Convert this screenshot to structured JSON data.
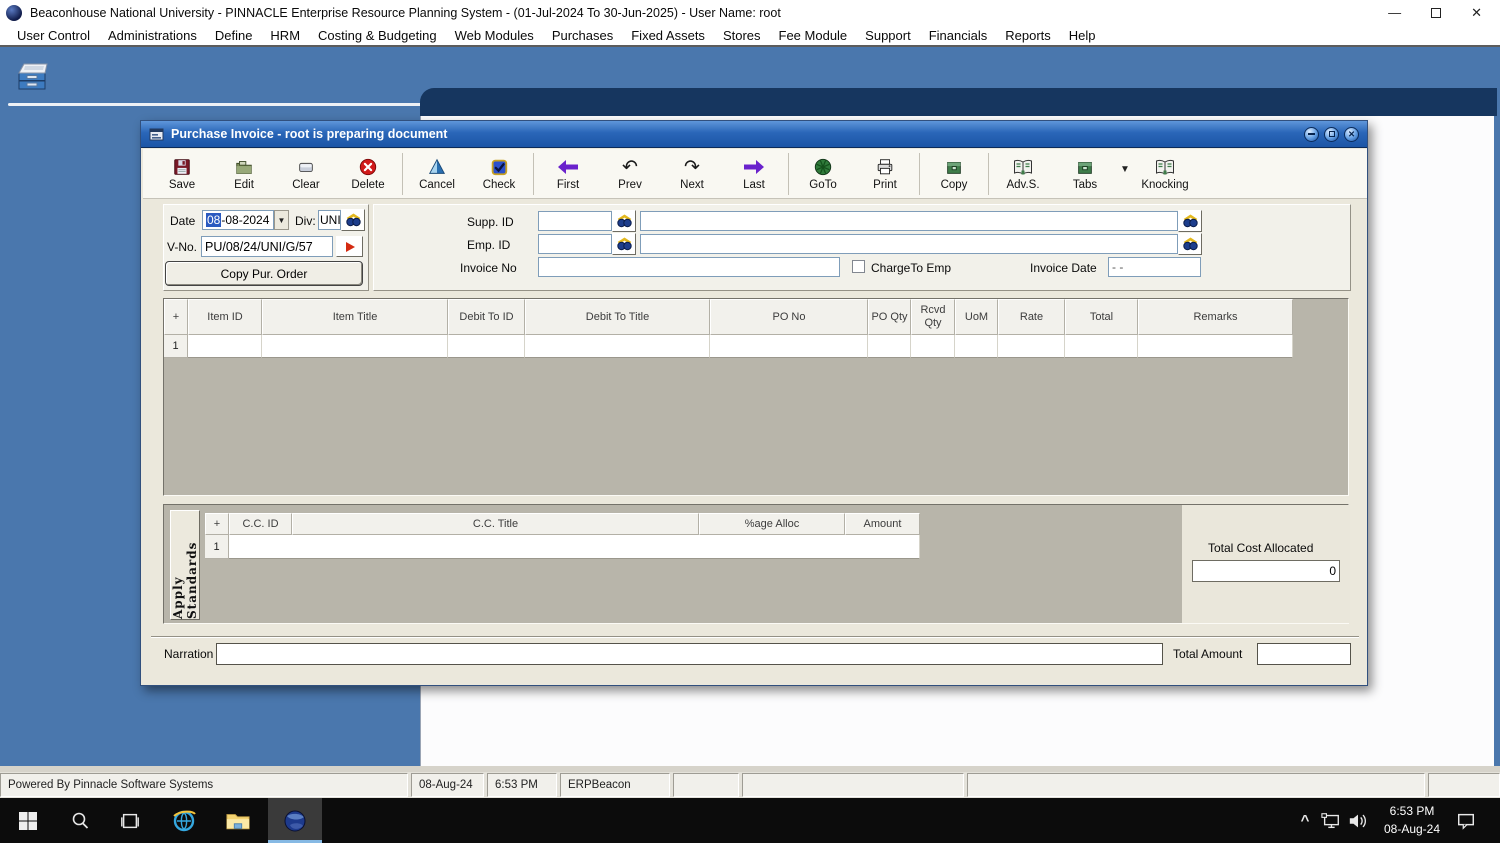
{
  "window": {
    "title": "Beaconhouse National University - PINNACLE Enterprise Resource Planning System - (01-Jul-2024 To 30-Jun-2025) - User Name: root"
  },
  "menubar": {
    "items": [
      "User Control",
      "Administrations",
      "Define",
      "HRM",
      "Costing & Budgeting",
      "Web Modules",
      "Purchases",
      "Fixed Assets",
      "Stores",
      "Fee Module",
      "Support",
      "Financials",
      "Reports",
      "Help"
    ]
  },
  "dialog": {
    "title": "Purchase Invoice - root is preparing document",
    "toolbar": {
      "buttons": [
        "Save",
        "Edit",
        "Clear",
        "Delete",
        "Cancel",
        "Check",
        "First",
        "Prev",
        "Next",
        "Last",
        "GoTo",
        "Print",
        "Copy",
        "Adv.S.",
        "Tabs",
        "Knocking"
      ]
    },
    "form": {
      "date_label": "Date",
      "date_day": "08",
      "date_rest": "-08-2024",
      "div_label": "Div:",
      "div_value": "UNI",
      "vno_label": "V-No.",
      "vno_value": "PU/08/24/UNI/G/57",
      "copy_po": "Copy Pur. Order",
      "supp_id_label": "Supp. ID",
      "emp_id_label": "Emp. ID",
      "invoice_no_label": "Invoice No",
      "chargeto_label": "ChargeTo Emp",
      "invoice_date_label": "Invoice Date",
      "invoice_date_value": "- -"
    },
    "items_grid": {
      "columns": [
        "+",
        "Item ID",
        "Item Title",
        "Debit To ID",
        "Debit To Title",
        "PO No",
        "PO Qty",
        "Rcvd Qty",
        "UoM",
        "Rate",
        "Total",
        "Remarks"
      ],
      "row_no": "1"
    },
    "cc_grid": {
      "columns": [
        "+",
        "C.C. ID",
        "C.C. Title",
        "%age Alloc",
        "Amount"
      ],
      "row_no": "1"
    },
    "apply_standards": "Apply Standards",
    "total_cost_allocated_label": "Total Cost Allocated",
    "total_cost_allocated_value": "0",
    "narration_label": "Narration",
    "total_amount_label": "Total Amount"
  },
  "statusbar": {
    "cells": [
      "Powered By Pinnacle Software Systems",
      "08-Aug-24",
      "6:53 PM",
      "ERPBeacon",
      "",
      "",
      "",
      ""
    ]
  },
  "taskbar": {
    "time": "6:53 PM",
    "date": "08-Aug-24"
  },
  "colors": {
    "desktop_blue": "#4a77ad",
    "navy_tab": "#16365f",
    "dialog_titlebar_blue": "#2a66b8",
    "dialog_body": "#ebe8dc",
    "grid_gray": "#b8b5aa",
    "delete_red": "#d11a1a",
    "nav_arrow_purple": "#6a22cc",
    "taskbar_black": "#0c0c0c",
    "taskbar_accent": "#86b9e4"
  }
}
